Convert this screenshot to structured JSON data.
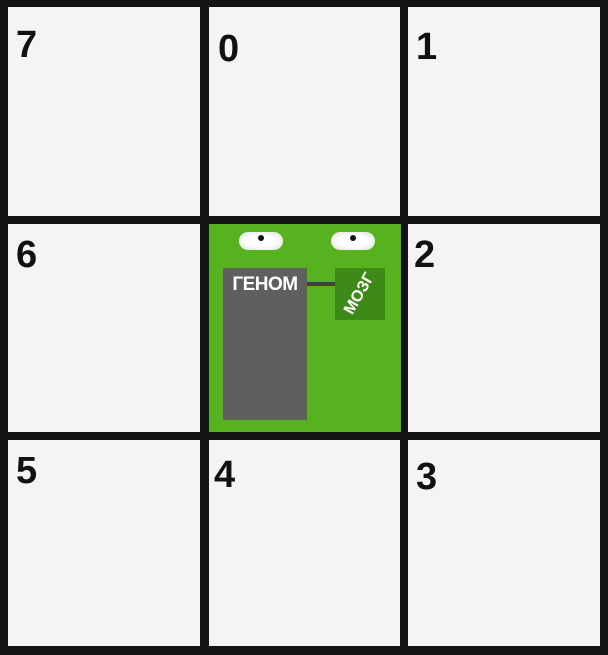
{
  "cells": [
    {
      "id": "cell-7",
      "number": "7"
    },
    {
      "id": "cell-0",
      "number": "0"
    },
    {
      "id": "cell-1",
      "number": "1"
    },
    {
      "id": "cell-6",
      "number": "6"
    },
    {
      "id": "cell-2",
      "number": "2"
    },
    {
      "id": "cell-5",
      "number": "5"
    },
    {
      "id": "cell-4",
      "number": "4"
    },
    {
      "id": "cell-3",
      "number": "3"
    }
  ],
  "creature": {
    "genome_label": "ГЕНОМ",
    "brain_label": "МОЗГ",
    "body_color": "#56b21e",
    "genome_color": "#5f5f5f",
    "brain_color": "#3e8a19"
  },
  "colors": {
    "background": "#f4f4f4",
    "grid_lines": "#141414",
    "numbers": "#111111"
  }
}
